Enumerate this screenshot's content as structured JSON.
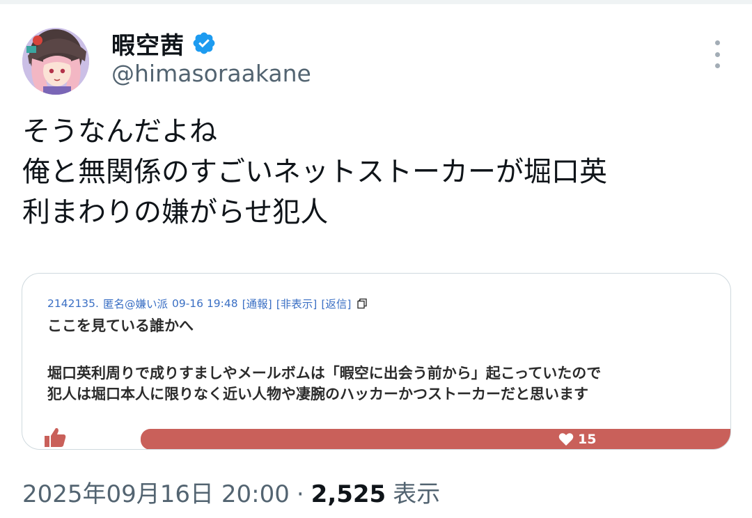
{
  "user": {
    "display_name": "暇空茜",
    "handle": "@himasoraakane",
    "verified": true,
    "avatar_icon": "avatar-illustration-icon",
    "verified_color": "#1d9bf0"
  },
  "tweet": {
    "lines": [
      "そうなんだよね",
      "俺と無関係のすごいネットストーカーが堀口英",
      "利まわりの嫌がらせ犯人"
    ]
  },
  "embedded_post": {
    "meta": {
      "id": "2142135.",
      "name": "匿名@嫌い派",
      "datetime": "09-16 19:48",
      "report_link": "[通報]",
      "hide_link": "[非表示]",
      "reply_link": "[返信]"
    },
    "body_lines": [
      "ここを見ている誰かへ",
      "",
      "堀口英利周りで成りすましやメールボムは「暇空に出会う前から」起こっていたので",
      "犯人は堀口本人に限りなく近い人物や凄腕のハッカーかつストーカーだと思います"
    ],
    "like_fraction": 0.0,
    "heart_count": "15",
    "bar_color": "#c9605a",
    "link_color": "#3a6fc4"
  },
  "footer": {
    "timestamp": "2025年09月16日 20:00",
    "separator": "·",
    "view_count": "2,525",
    "view_label": "表示"
  }
}
